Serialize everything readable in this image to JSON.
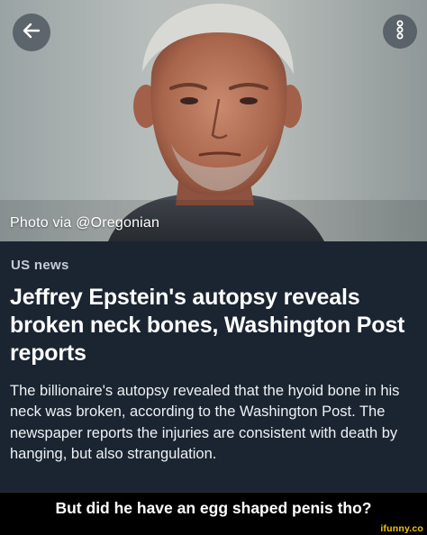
{
  "photo": {
    "caption": "Photo via @Oregonian"
  },
  "article": {
    "category": "US news",
    "headline": "Jeffrey Epstein's autopsy reveals broken neck bones, Washington Post reports",
    "summary": "The billionaire's autopsy revealed that the hyoid bone in his neck was broken, according to the Washington Post. The newspaper reports the injuries are consistent with death by hanging, but also strangulation."
  },
  "meme": {
    "caption": "But did he have an egg shaped penis tho?",
    "watermark": "ifunny.co"
  },
  "icons": {
    "back": "arrow-left-icon",
    "more": "more-vertical-icon"
  },
  "colors": {
    "background": "#1b2431",
    "caption_bar": "#000000",
    "watermark": "#f5c400"
  }
}
